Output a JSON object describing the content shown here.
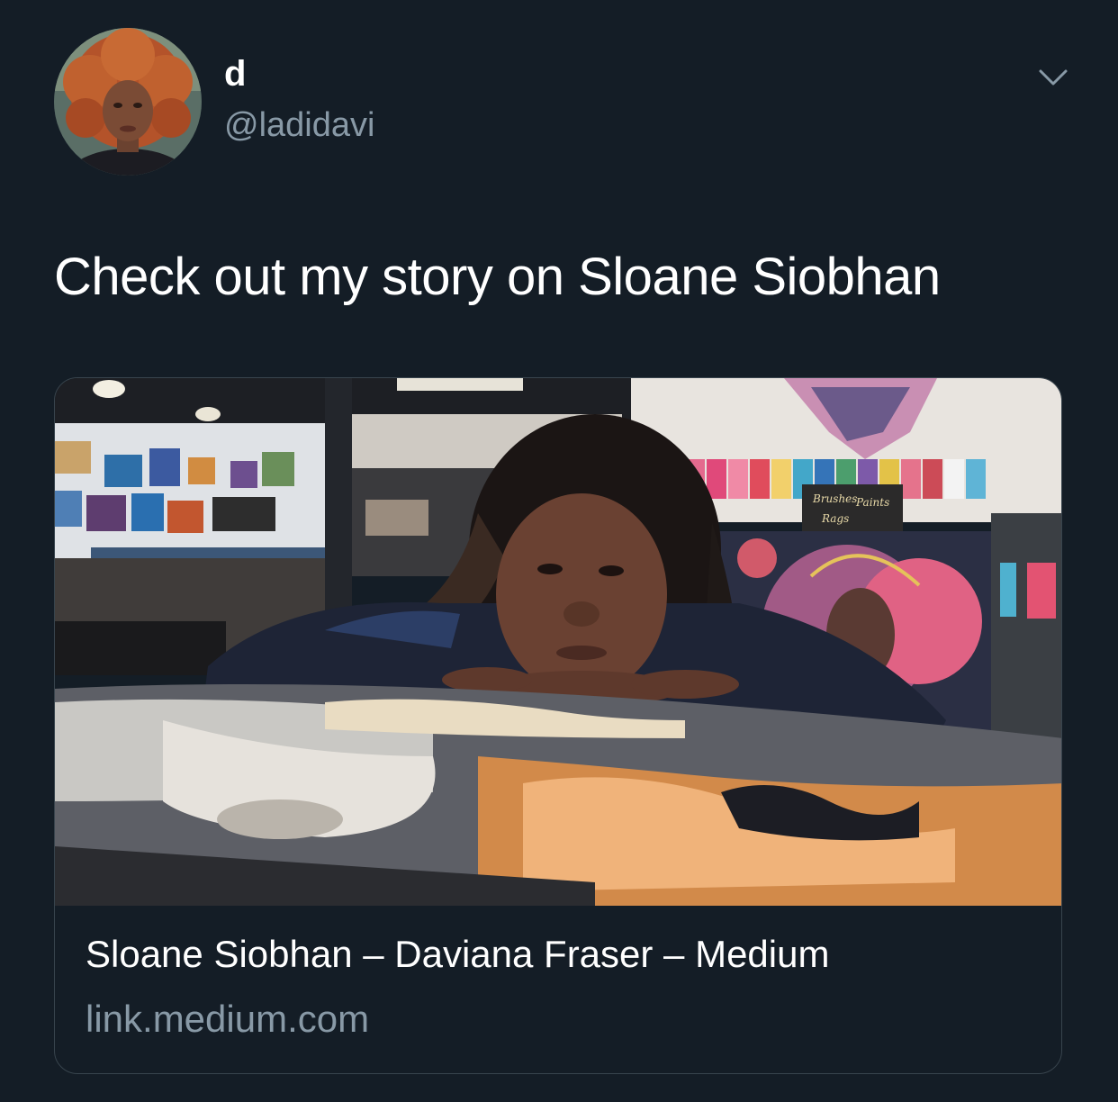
{
  "tweet": {
    "author": {
      "display_name": "d",
      "handle": "@ladidavi",
      "avatar_icon": "profile-photo"
    },
    "menu_icon": "chevron-down-icon",
    "text": "Check out my story on Sloane Siobhan",
    "link_card": {
      "title": "Sloane Siobhan – Daviana Fraser – Medium",
      "domain": "link.medium.com",
      "image": "photo-artist-leaning-on-painting",
      "image_signs": {
        "line1": "Brushes",
        "line2": "Paints",
        "line3": "Rags"
      }
    }
  },
  "colors": {
    "background": "#141d26",
    "text_primary": "#ffffff",
    "text_secondary": "#8899a6",
    "card_border": "#38444d"
  }
}
